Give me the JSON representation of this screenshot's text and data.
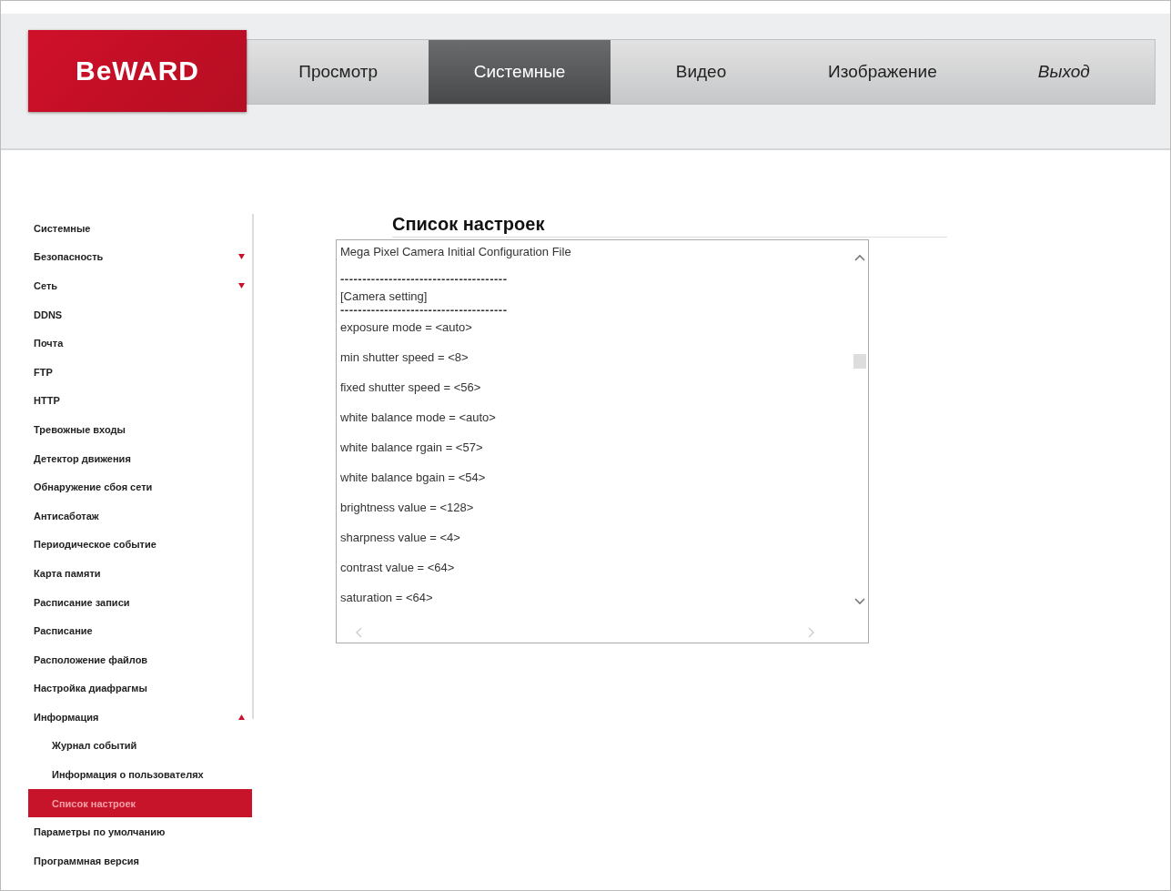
{
  "logo": {
    "text": "BeWARD"
  },
  "nav_tabs": [
    {
      "label": "Просмотр",
      "selected": false,
      "kind": "tab"
    },
    {
      "label": "Системные",
      "selected": true,
      "kind": "tab"
    },
    {
      "label": "Видео",
      "selected": false,
      "kind": "tab"
    },
    {
      "label": "Изображение",
      "selected": false,
      "kind": "tab"
    },
    {
      "label": "Выход",
      "selected": false,
      "kind": "logout"
    }
  ],
  "sidebar": {
    "items": [
      {
        "label": "Системные",
        "selected": false
      },
      {
        "label": "Безопасность",
        "selected": false,
        "expanded": false
      },
      {
        "label": "Сеть",
        "selected": false,
        "expanded": false
      },
      {
        "label": "DDNS",
        "selected": false
      },
      {
        "label": "Почта",
        "selected": false
      },
      {
        "label": "FTP",
        "selected": false
      },
      {
        "label": "HTTP",
        "selected": false
      },
      {
        "label": "Тревожные входы",
        "selected": false
      },
      {
        "label": "Детектор движения",
        "selected": false
      },
      {
        "label": "Обнаружение сбоя сети",
        "selected": false
      },
      {
        "label": "Антисаботаж",
        "selected": false
      },
      {
        "label": "Периодическое событие",
        "selected": false
      },
      {
        "label": "Карта памяти",
        "selected": false
      },
      {
        "label": "Расписание записи",
        "selected": false
      },
      {
        "label": "Расписание",
        "selected": false
      },
      {
        "label": "Расположение файлов",
        "selected": false
      },
      {
        "label": "Настройка диафрагмы",
        "selected": false
      },
      {
        "label": "Информация",
        "selected": false,
        "expanded": true,
        "children": [
          {
            "label": "Журнал событий",
            "selected": false
          },
          {
            "label": "Информация о пользователях",
            "selected": false
          },
          {
            "label": "Список настроек",
            "selected": true
          }
        ]
      },
      {
        "label": "Параметры по умолчанию",
        "selected": false
      },
      {
        "label": "Программная версия",
        "selected": false
      }
    ]
  },
  "main": {
    "title": "Список настроек",
    "config_lines": [
      "Mega Pixel Camera Initial Configuration File",
      "--------------------------------------",
      "[Camera setting]",
      "--------------------------------------",
      "exposure mode = <auto>",
      "min shutter speed = <8>",
      "fixed shutter speed = <56>",
      "white balance mode = <auto>",
      "white balance rgain = <57>",
      "white balance bgain = <54>",
      "brightness value = <128>",
      "sharpness value = <4>",
      "contrast value = <64>",
      "saturation = <64>"
    ]
  }
}
